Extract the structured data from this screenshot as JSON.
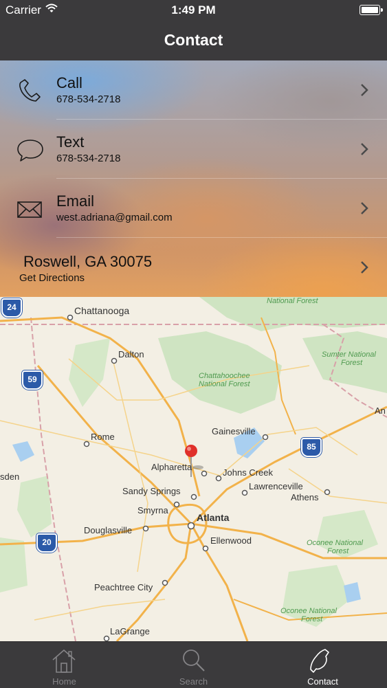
{
  "status_bar": {
    "carrier": "Carrier",
    "time": "1:49 PM"
  },
  "nav": {
    "title": "Contact"
  },
  "contact_rows": [
    {
      "title": "Call",
      "subtitle": "678-534-2718",
      "icon": "phone-icon"
    },
    {
      "title": "Text",
      "subtitle": "678-534-2718",
      "icon": "chat-bubble-icon"
    },
    {
      "title": "Email",
      "subtitle": "west.adriana@gmail.com",
      "icon": "envelope-icon"
    }
  ],
  "address": {
    "title": "Roswell, GA 30075",
    "subtitle": "Get Directions"
  },
  "map": {
    "labels": {
      "chattanooga": "Chattanooga",
      "dalton": "Dalton",
      "rome": "Rome",
      "gainesville": "Gainesville",
      "alpharetta": "Alpharetta",
      "johns_creek": "Johns Creek",
      "sandy_springs": "Sandy Springs",
      "lawrenceville": "Lawrenceville",
      "athens": "Athens",
      "smyrna": "Smyrna",
      "atlanta": "Atlanta",
      "douglasville": "Douglasville",
      "ellenwood": "Ellenwood",
      "peachtree_city": "Peachtree City",
      "lagrange": "LaGrange",
      "sden": "sden",
      "an": "An",
      "national_forest": "National Forest",
      "sumter_1": "Sumter National",
      "sumter_2": "Forest",
      "chatt_nf_1": "Chattahoochee",
      "chatt_nf_2": "National Forest",
      "oconee_1_a": "Oconee National",
      "oconee_1_b": "Forest",
      "oconee_2_a": "Oconee National",
      "oconee_2_b": "Forest"
    },
    "shields": {
      "i24": "24",
      "i59": "59",
      "i85": "85",
      "i20": "20"
    }
  },
  "tabs": [
    {
      "label": "Home",
      "icon": "house-icon",
      "active": false
    },
    {
      "label": "Search",
      "icon": "magnifier-icon",
      "active": false
    },
    {
      "label": "Contact",
      "icon": "phone-icon",
      "active": true
    }
  ],
  "colors": {
    "bar_bg": "#3b3a3c",
    "tab_inactive": "#858487",
    "tab_active": "#ffffff",
    "pin": "#e0302a",
    "forest_text": "#4f9a4f"
  }
}
